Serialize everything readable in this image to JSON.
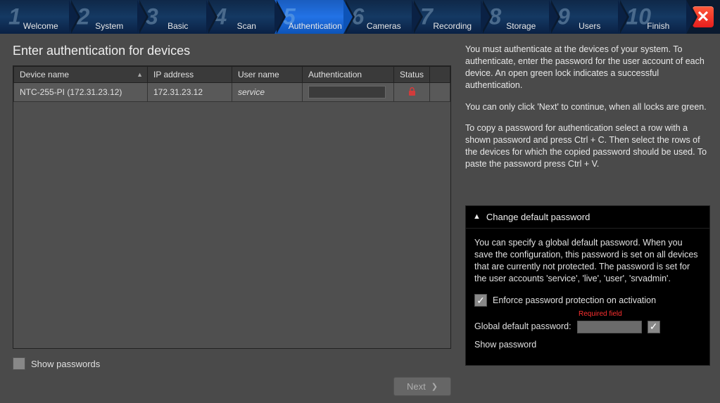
{
  "wizard": {
    "steps": [
      {
        "num": "1",
        "label": "Welcome"
      },
      {
        "num": "2",
        "label": "System"
      },
      {
        "num": "3",
        "label": "Basic"
      },
      {
        "num": "4",
        "label": "Scan"
      },
      {
        "num": "5",
        "label": "Authentication"
      },
      {
        "num": "6",
        "label": "Cameras"
      },
      {
        "num": "7",
        "label": "Recording"
      },
      {
        "num": "8",
        "label": "Storage"
      },
      {
        "num": "9",
        "label": "Users"
      },
      {
        "num": "10",
        "label": "Finish"
      }
    ],
    "active_index": 4
  },
  "panel": {
    "title": "Enter authentication for devices",
    "columns": {
      "device_name": "Device name",
      "ip": "IP address",
      "user": "User name",
      "auth": "Authentication",
      "status": "Status"
    },
    "rows": [
      {
        "device_name": "NTC-255-PI (172.31.23.12)",
        "ip": "172.31.23.12",
        "user": "service",
        "auth": "",
        "locked": true
      }
    ],
    "show_passwords_label": "Show passwords",
    "next_label": "Next"
  },
  "info": {
    "p1": "You must authenticate at the devices of your system. To authenticate, enter the password for the user account of each device. An open green lock indicates a successful authentication.",
    "p2": "You can only click 'Next' to continue, when all locks are green.",
    "p3": "To copy a password for authentication select a row with a shown password and press Ctrl + C. Then select the rows of the devices for which the copied password should be used. To paste the password press Ctrl + V."
  },
  "accordion": {
    "title": "Change default password",
    "body": "You can specify a global default password. When you save the configuration, this password is set on all devices that are currently not protected. The password is set for the user accounts 'service', 'live', 'user', 'srvadmin'.",
    "enforce_label": "Enforce password protection on activation",
    "required_label": "Required field",
    "global_pw_label": "Global default password:",
    "show_pw_label": "Show password"
  }
}
